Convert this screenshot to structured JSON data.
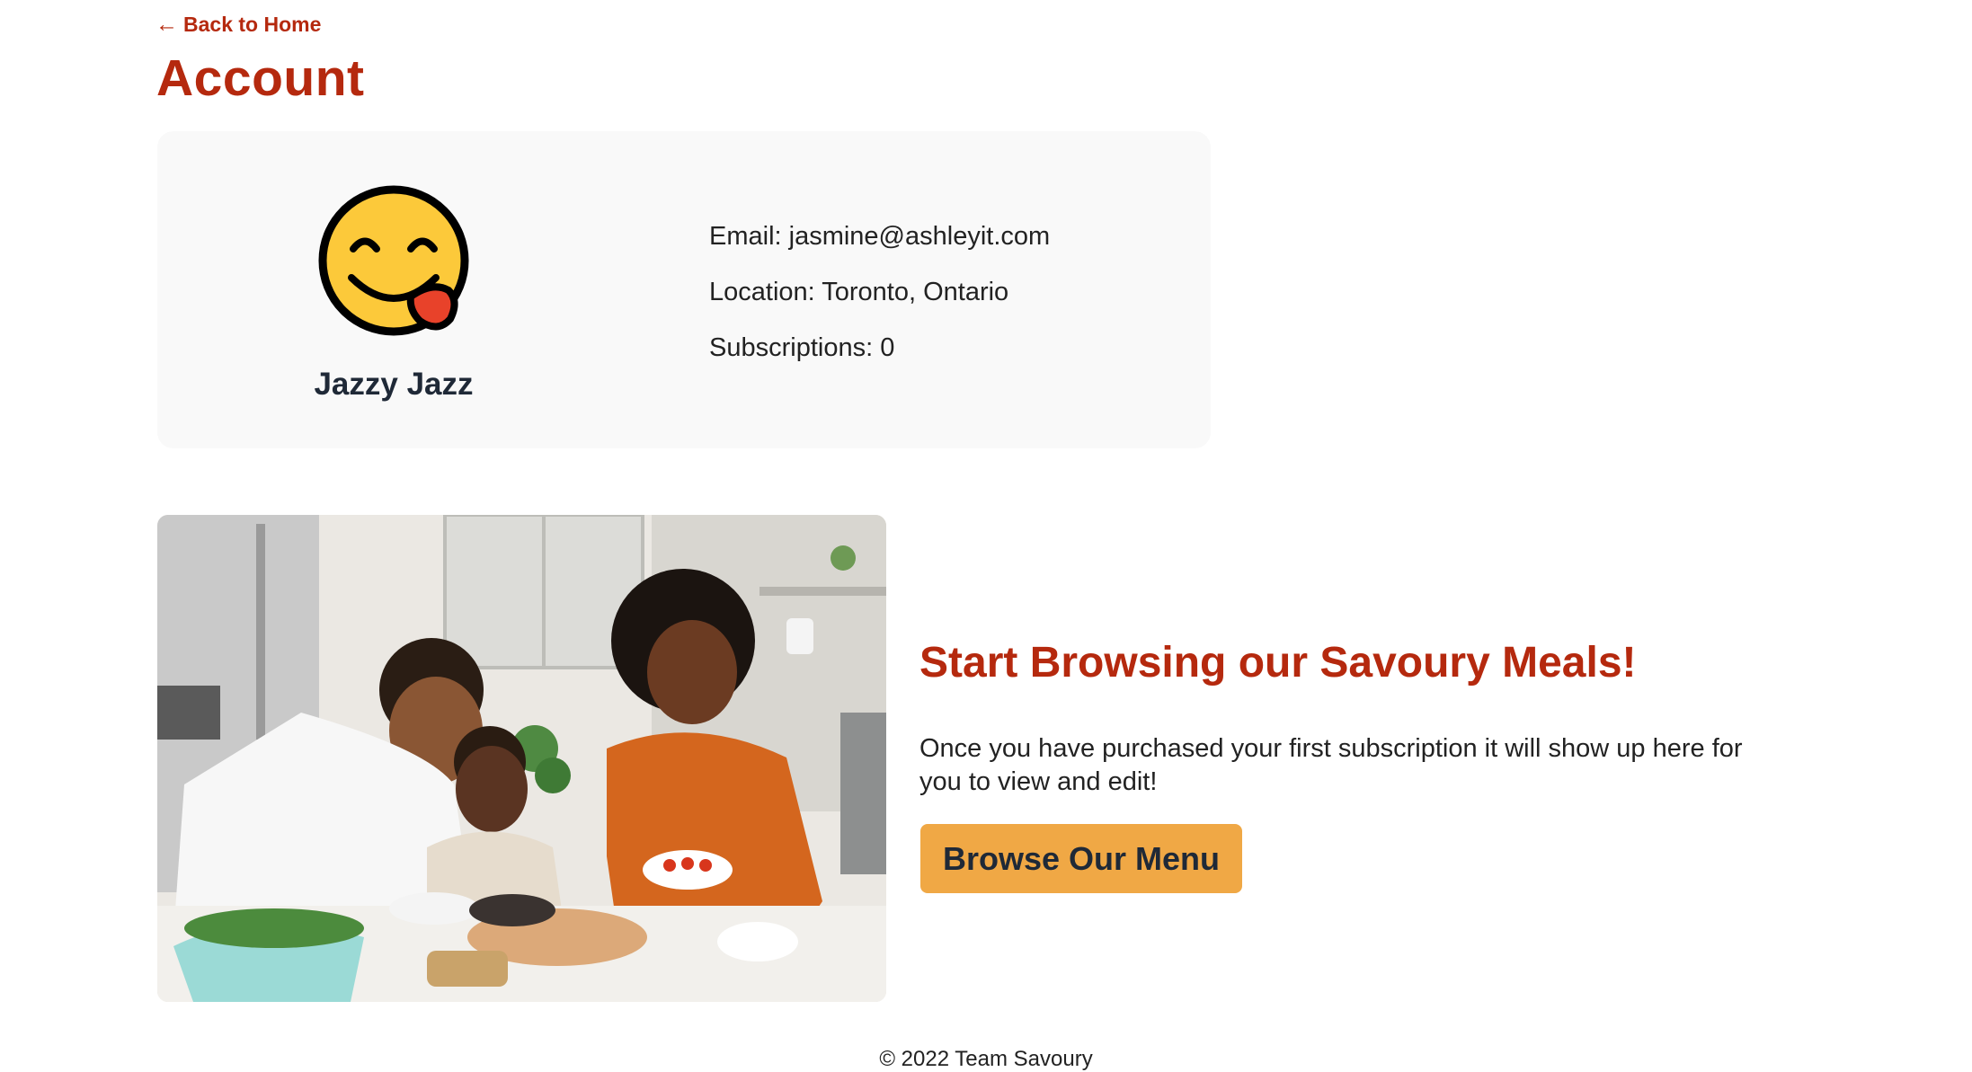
{
  "nav": {
    "back_arrow": "←",
    "back_label": "Back to Home"
  },
  "page": {
    "title": "Account"
  },
  "profile": {
    "avatar_icon": "face-savoring-food-emoji-icon",
    "name": "Jazzy Jazz",
    "email_line": "Email: jasmine@ashleyit.com",
    "location_line": "Location: Toronto, Ontario",
    "subscriptions_line": "Subscriptions: 0"
  },
  "promo": {
    "heading": "Start Browsing our Savoury Meals!",
    "body": "Once you have purchased your first subscription it will show up here for you to view and edit!",
    "button_label": "Browse Our Menu"
  },
  "footer": {
    "copyright": "© 2022 Team Savoury"
  },
  "colors": {
    "brand_red": "#b5290e",
    "button_orange": "#f0a845",
    "card_background": "#f9f9f9",
    "text_dark": "#1f2937"
  }
}
